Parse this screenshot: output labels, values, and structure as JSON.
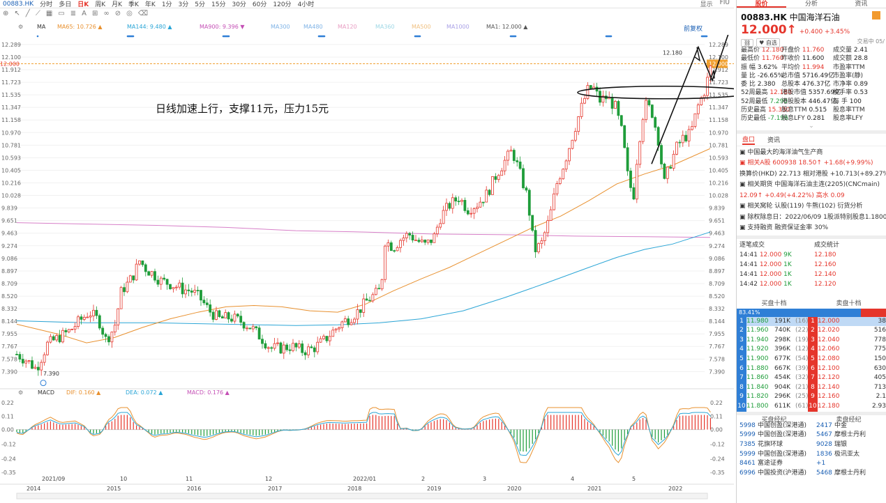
{
  "toolbar": {
    "code": "00883.HK",
    "items": [
      "分时",
      "多日",
      "日K",
      "周K",
      "月K",
      "季K",
      "年K",
      "1分",
      "3分",
      "5分",
      "15分",
      "30分",
      "60分",
      "120分",
      "4小时"
    ],
    "right": [
      "显示",
      "FIU"
    ]
  },
  "indicators": {
    "ma": "MA",
    "ma65": "MA65: 10.726 ▲",
    "ma144": "MA144: 9.480 ▲",
    "ma900": "MA900: 9.396 ▼",
    "ma300": "MA300",
    "ma480": "MA480",
    "ma120": "MA120",
    "ma360": "MA360",
    "ma500": "MA500",
    "ma1000": "MA1000",
    "ma1": "MA1: 12.000 ▲",
    "fq": "前复权"
  },
  "annotation": "日线加速上行，支撑11元，压力15元",
  "colors": {
    "up": "#e5352b",
    "down": "#1f9d3a",
    "ma65": "#e8902e",
    "ma144": "#2aa5d6",
    "ma900": "#d77fc8",
    "annot": "#111"
  },
  "chart_data": {
    "type": "candlestick",
    "ticker": "00883.HK",
    "y_ticks": [
      "12.289",
      "12.100",
      "11.912",
      "11.723",
      "11.535",
      "11.347",
      "11.158",
      "10.970",
      "10.781",
      "10.593",
      "10.405",
      "10.216",
      "10.028",
      "9.839",
      "9.651",
      "9.463",
      "9.274",
      "9.086",
      "8.897",
      "8.709",
      "8.520",
      "8.332",
      "8.144",
      "7.955",
      "7.767",
      "7.578",
      "7.390"
    ],
    "y_label_current": "12.000",
    "ylim": [
      7.3,
      12.35
    ],
    "x_ticks_top": [
      "2021/09",
      "10",
      "11",
      "12",
      "2022/01",
      "2",
      "3",
      "4",
      "5"
    ],
    "x_ticks_bottom": [
      "2014",
      "2015",
      "2016",
      "2017",
      "2018",
      "2019",
      "2020",
      "2021",
      "2022"
    ],
    "high_marker": "12.180",
    "low_marker": "7.390",
    "price_path": [
      [
        0,
        7.65
      ],
      [
        14,
        7.56
      ],
      [
        28,
        7.43
      ],
      [
        44,
        7.8
      ],
      [
        60,
        7.9
      ],
      [
        76,
        8.0
      ],
      [
        90,
        8.15
      ],
      [
        104,
        8.28
      ],
      [
        118,
        8.15
      ],
      [
        128,
        7.86
      ],
      [
        140,
        8.05
      ],
      [
        150,
        8.6
      ],
      [
        160,
        8.72
      ],
      [
        168,
        8.85
      ],
      [
        176,
        9.05
      ],
      [
        186,
        8.92
      ],
      [
        196,
        8.85
      ],
      [
        206,
        8.75
      ],
      [
        216,
        8.72
      ],
      [
        226,
        8.68
      ],
      [
        238,
        8.62
      ],
      [
        250,
        8.6
      ],
      [
        262,
        8.5
      ],
      [
        276,
        8.3
      ],
      [
        290,
        8.18
      ],
      [
        306,
        8.2
      ],
      [
        320,
        8.15
      ],
      [
        336,
        8.05
      ],
      [
        350,
        7.9
      ],
      [
        364,
        7.74
      ],
      [
        378,
        7.74
      ],
      [
        394,
        7.77
      ],
      [
        410,
        7.7
      ],
      [
        424,
        7.73
      ],
      [
        440,
        7.85
      ],
      [
        454,
        8.0
      ],
      [
        466,
        8.12
      ],
      [
        478,
        8.2
      ],
      [
        490,
        8.3
      ],
      [
        502,
        8.45
      ],
      [
        514,
        8.55
      ],
      [
        522,
        8.62
      ],
      [
        528,
        9.35
      ],
      [
        540,
        9.25
      ],
      [
        550,
        9.37
      ],
      [
        562,
        9.45
      ],
      [
        574,
        9.35
      ],
      [
        586,
        9.28
      ],
      [
        598,
        9.4
      ],
      [
        608,
        9.72
      ],
      [
        620,
        9.88
      ],
      [
        634,
        10.0
      ],
      [
        646,
        9.82
      ],
      [
        660,
        9.9
      ],
      [
        674,
        10.05
      ],
      [
        688,
        10.35
      ],
      [
        700,
        10.55
      ],
      [
        710,
        10.7
      ],
      [
        720,
        10.4
      ],
      [
        732,
        10.0
      ],
      [
        742,
        9.2
      ],
      [
        752,
        9.3
      ],
      [
        764,
        9.7
      ],
      [
        774,
        10.2
      ],
      [
        786,
        10.55
      ],
      [
        796,
        10.9
      ],
      [
        808,
        11.3
      ],
      [
        818,
        11.6
      ],
      [
        826,
        11.65
      ],
      [
        836,
        11.45
      ],
      [
        846,
        11.5
      ],
      [
        858,
        11.35
      ],
      [
        868,
        10.95
      ],
      [
        876,
        10.3
      ],
      [
        884,
        10.0
      ],
      [
        890,
        10.7
      ],
      [
        900,
        11.4
      ],
      [
        910,
        11.3
      ],
      [
        920,
        10.85
      ],
      [
        928,
        10.2
      ],
      [
        936,
        10.48
      ],
      [
        946,
        10.75
      ],
      [
        956,
        10.9
      ],
      [
        966,
        10.95
      ],
      [
        976,
        11.35
      ],
      [
        986,
        11.6
      ],
      [
        996,
        12.0
      ]
    ],
    "ma65": [
      [
        0,
        8.1
      ],
      [
        60,
        7.95
      ],
      [
        100,
        7.82
      ],
      [
        140,
        7.9
      ],
      [
        180,
        8.05
      ],
      [
        220,
        8.18
      ],
      [
        260,
        8.28
      ],
      [
        300,
        8.36
      ],
      [
        340,
        8.38
      ],
      [
        380,
        8.36
      ],
      [
        420,
        8.3
      ],
      [
        460,
        8.28
      ],
      [
        500,
        8.4
      ],
      [
        540,
        8.6
      ],
      [
        580,
        8.78
      ],
      [
        620,
        8.95
      ],
      [
        660,
        9.15
      ],
      [
        700,
        9.35
      ],
      [
        740,
        9.55
      ],
      [
        780,
        9.72
      ],
      [
        820,
        9.95
      ],
      [
        860,
        10.2
      ],
      [
        900,
        10.35
      ],
      [
        940,
        10.48
      ],
      [
        994,
        10.73
      ]
    ],
    "ma144": [
      [
        0,
        8.15
      ],
      [
        100,
        8.12
      ],
      [
        200,
        8.12
      ],
      [
        300,
        8.1
      ],
      [
        400,
        8.08
      ],
      [
        460,
        8.09
      ],
      [
        520,
        8.12
      ],
      [
        580,
        8.18
      ],
      [
        640,
        8.3
      ],
      [
        700,
        8.5
      ],
      [
        760,
        8.72
      ],
      [
        820,
        8.95
      ],
      [
        860,
        9.1
      ],
      [
        900,
        9.22
      ],
      [
        940,
        9.3
      ],
      [
        994,
        9.48
      ]
    ],
    "ma900": [
      [
        0,
        9.62
      ],
      [
        100,
        9.6
      ],
      [
        200,
        9.58
      ],
      [
        300,
        9.55
      ],
      [
        400,
        9.5
      ],
      [
        500,
        9.48
      ],
      [
        600,
        9.45
      ],
      [
        700,
        9.44
      ],
      [
        800,
        9.42
      ],
      [
        900,
        9.41
      ],
      [
        994,
        9.4
      ]
    ],
    "macd": {
      "yticks": [
        "0.22",
        "0.11",
        "0.00",
        "-0.12",
        "-0.24",
        "-0.35"
      ],
      "dif": "DIF: 0.160 ▲",
      "dea": "DEA: 0.072 ▲",
      "macd": "MACD: 0.176 ▲"
    }
  },
  "quote": {
    "tabs": [
      "股价",
      "分析",
      "资讯"
    ],
    "code": "00883.HK",
    "name": "中国海洋石油",
    "price": "12.000↑",
    "change": "+0.400 +3.45%",
    "time": "交易中 05/",
    "tags": [
      "自选"
    ],
    "rows": [
      [
        [
          "最高价",
          "12.180",
          "r"
        ],
        [
          "开盘价",
          "11.760",
          "r"
        ],
        [
          "成交量",
          "2.41",
          "k"
        ]
      ],
      [
        [
          "最低价",
          "11.760",
          "r"
        ],
        [
          "昨收价",
          "11.600",
          "k"
        ],
        [
          "成交额",
          "28.8",
          "k"
        ]
      ],
      [
        [
          "振 幅",
          "3.62%",
          "k"
        ],
        [
          "平均价",
          "11.994",
          "r"
        ],
        [
          "市盈率TTM",
          "",
          "k"
        ]
      ],
      [
        [
          "量 比",
          "-26.65%",
          "k"
        ],
        [
          "总市值",
          "5716.49亿",
          "k"
        ],
        [
          "市盈率(静)",
          "",
          "k"
        ]
      ],
      [
        [
          "委 比",
          "2.380",
          "k"
        ],
        [
          "总股本",
          "476.37亿",
          "k"
        ],
        [
          "市净率",
          "0.89",
          "k"
        ]
      ],
      [
        [
          "52周最高",
          "12.180",
          "r"
        ],
        [
          "港股市值",
          "5357.69亿",
          "k"
        ],
        [
          "换手率",
          "0.53",
          "k"
        ]
      ],
      [
        [
          "52周最低",
          "7.290",
          "g"
        ],
        [
          "港股股本",
          "446.47亿",
          "k"
        ],
        [
          "每 手",
          "100",
          "k"
        ]
      ],
      [
        [
          "历史最高",
          "15.330",
          "r"
        ],
        [
          "股息TTM",
          "0.515",
          "k"
        ],
        [
          "股息率TTM",
          "",
          "k"
        ]
      ],
      [
        [
          "历史最低",
          "-7.196",
          "g"
        ],
        [
          "股息LFY",
          "0.281",
          "k"
        ],
        [
          "股息率LFY",
          "",
          "k"
        ]
      ]
    ]
  },
  "fund": {
    "tabs": [
      "盘口",
      "资讯"
    ],
    "lines": [
      "中国最大的海洋油气生产商",
      "相关A股  600938  18.50↑ +1.68(+9.99%)",
      "换算价(HKD) 22.713  相对港股 +10.713(+89.27%",
      "相关期货  中国海洋石油主连(2205)(CNCmain)",
      "12.09↑ +0.49(+4.22%)  高水  0.09",
      "相关窝轮  认股(119)  牛熊(102)  衍货分析",
      "除权除息日：2022/06/09  1股派特别股息1.18000H",
      "支持融资  融资保证金率 30%"
    ]
  },
  "ticks": {
    "title1": "逐笔成交",
    "title2": "成交统计",
    "rows": [
      [
        "14:41",
        "12.000",
        "9K"
      ],
      [
        "14:41",
        "12.000",
        "1K"
      ],
      [
        "14:41",
        "12.000",
        "1K"
      ],
      [
        "14:42",
        "12.000",
        "1K"
      ]
    ],
    "stats": [
      "12.180",
      "12.160",
      "12.140",
      "12.120"
    ]
  },
  "book": {
    "buy": "买盘十档",
    "sell": "卖盘十档",
    "pct": "83.41%",
    "levels": [
      [
        "1",
        "11.980",
        "191K",
        "(16)",
        "1",
        "12.000",
        "38"
      ],
      [
        "2",
        "11.960",
        "740K",
        "(22)",
        "2",
        "12.020",
        "516"
      ],
      [
        "3",
        "11.940",
        "298K",
        "(19)",
        "3",
        "12.040",
        "778"
      ],
      [
        "4",
        "11.920",
        "396K",
        "(12)",
        "4",
        "12.060",
        "775"
      ],
      [
        "5",
        "11.900",
        "677K",
        "(54)",
        "5",
        "12.080",
        "150"
      ],
      [
        "6",
        "11.880",
        "667K",
        "(39)",
        "6",
        "12.100",
        "630"
      ],
      [
        "7",
        "11.860",
        "454K",
        "(32)",
        "7",
        "12.120",
        "405"
      ],
      [
        "8",
        "11.840",
        "904K",
        "(21)",
        "8",
        "12.140",
        "713"
      ],
      [
        "9",
        "11.820",
        "296K",
        "(25)",
        "9",
        "12.160",
        "2.1"
      ],
      [
        "10",
        "11.800",
        "611K",
        "(61)",
        "10",
        "12.180",
        "2.93"
      ]
    ]
  },
  "brokers": {
    "buy": "买盘经纪",
    "sell": "卖盘经纪",
    "rows": [
      [
        "5998",
        "中国创盈(深港通)",
        "2417",
        "中金"
      ],
      [
        "5999",
        "中国创盈(深港通)",
        "5467",
        "摩根士丹利"
      ],
      [
        "7385",
        "花旗环球",
        "9028",
        "瑞银"
      ],
      [
        "5999",
        "中国创盈(深港通)",
        "1836",
        "极讯亚太"
      ],
      [
        "8461",
        "富途证券",
        "+1",
        ""
      ],
      [
        "6996",
        "中国投资(沪港通)",
        "5468",
        "摩根士丹利"
      ]
    ]
  }
}
